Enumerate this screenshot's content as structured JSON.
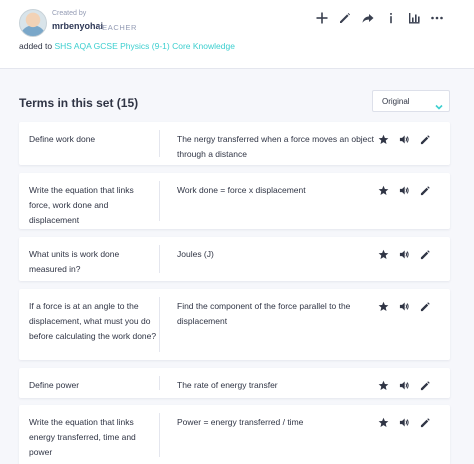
{
  "header": {
    "created_by_label": "Created by",
    "creator_name": "mrbenyohai",
    "creator_role": "TEACHER",
    "added_prefix": "added to",
    "set_name": "SHS AQA GCSE Physics (9-1) Core Knowledge"
  },
  "toolbar": {
    "icons": [
      "plus-icon",
      "pencil-icon",
      "share-icon",
      "info-icon",
      "stats-icon",
      "more-icon"
    ]
  },
  "terms_section": {
    "title": "Terms in this set (15)",
    "sort_value": "Original"
  },
  "cards": [
    {
      "term": "Define work done",
      "definition": "The nergy transferred when a force moves an object through a distance"
    },
    {
      "term": "Write the equation that links force, work done and displacement",
      "definition": "Work done = force x displacement"
    },
    {
      "term": "What units is work done measured in?",
      "definition": "Joules (J)"
    },
    {
      "term": "If a force is at an angle to the displacement, what must you do before calculating the work done?",
      "definition": "Find the component of the force parallel to the displacement"
    },
    {
      "term": "Define power",
      "definition": "The rate of energy transfer"
    },
    {
      "term": "Write the equation that links energy transferred, time and power",
      "definition": "Power = energy transferred / time"
    }
  ],
  "colors": {
    "accent": "#3ccfcf",
    "panel_bg": "#f6f7fb",
    "text": "#303545",
    "muted": "#939bb4"
  }
}
